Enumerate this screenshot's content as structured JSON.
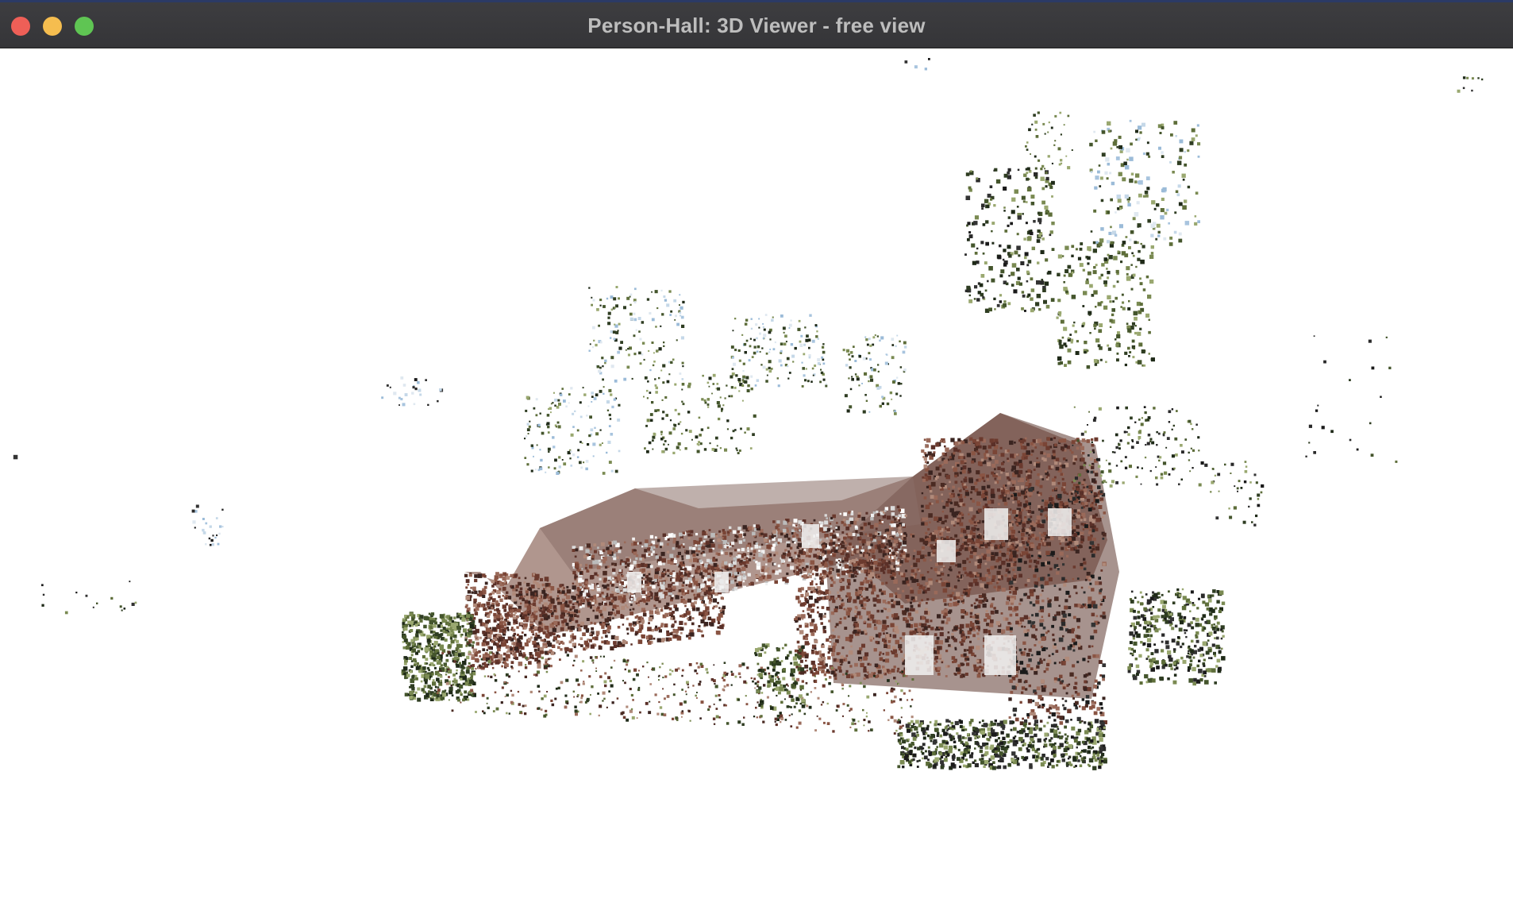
{
  "window": {
    "title": "Person-Hall: 3D Viewer - free view"
  },
  "titlebar_buttons": {
    "close_color": "#ee5f57",
    "minimize_color": "#f5bd4f",
    "zoom_color": "#5fc553"
  },
  "viewport": {
    "background": "#ffffff",
    "scene": "point-cloud",
    "palette": {
      "brick": [
        "#6b3a2e",
        "#7a4536",
        "#5a3028",
        "#8a5544",
        "#4a2a22",
        "#9a6a5a",
        "#3a2420",
        "#b08a7a"
      ],
      "foliage": [
        "#2f3d22",
        "#44552c",
        "#5e6e3a",
        "#1f2a18",
        "#7a8a52",
        "#9aa870"
      ],
      "sky": [
        "#9bbbd8",
        "#c5d8e8",
        "#a8c4de",
        "#dfe8f0"
      ],
      "dark": [
        "#1a1a1a",
        "#2a2a2a",
        "#333333"
      ],
      "window": [
        "#f0f0f0",
        "#dcdcdc",
        "#bcbcbc",
        "#ffffff"
      ]
    }
  }
}
